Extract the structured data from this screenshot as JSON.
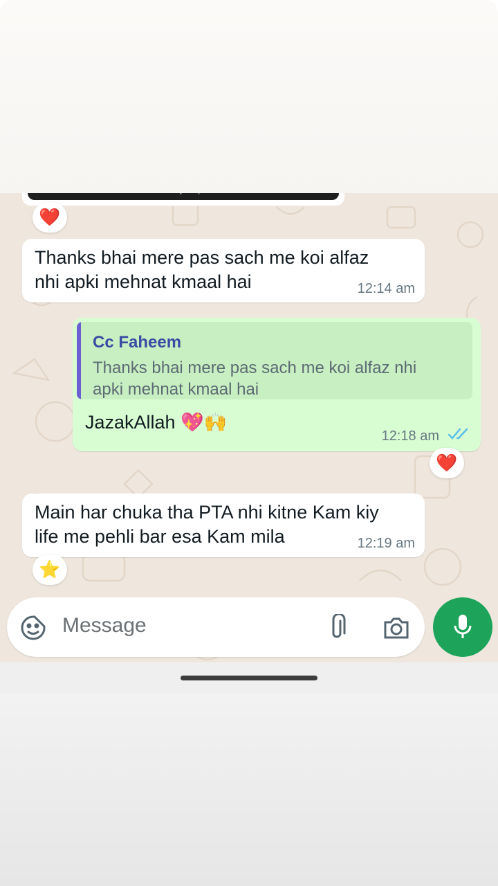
{
  "colors": {
    "chat_background": "#efe7de",
    "incoming_bubble": "#ffffff",
    "outgoing_bubble": "#d9fdd3",
    "quote_accent": "#6b5fd3",
    "read_ticks": "#53bdeb",
    "mic_button": "#1da45a"
  },
  "previous_message": {
    "clipped_text": "stuck with your product",
    "reaction": "❤️"
  },
  "messages": [
    {
      "direction": "incoming",
      "line1": "Thanks bhai mere pas sach me koi alfaz",
      "line2": "nhi apki mehnat kmaal hai",
      "time": "12:14 am"
    },
    {
      "direction": "outgoing",
      "quote_author": "Cc Faheem",
      "quote_line1": "Thanks bhai mere pas sach me koi alfaz nhi",
      "quote_line2": "apki mehnat kmaal hai",
      "text": "JazakAllah 💖🙌",
      "time": "12:18 am",
      "status": "read-double-tick-icon",
      "reaction": "❤️"
    },
    {
      "direction": "incoming",
      "line1": "Main har chuka tha PTA nhi kitne Kam kiy",
      "line2": "life me pehli bar esa Kam mila",
      "time": "12:19 am",
      "reaction": "⭐"
    }
  ],
  "composer": {
    "placeholder": "Message",
    "icons": [
      "sticker-icon",
      "attach-icon",
      "camera-icon",
      "mic-icon"
    ]
  }
}
